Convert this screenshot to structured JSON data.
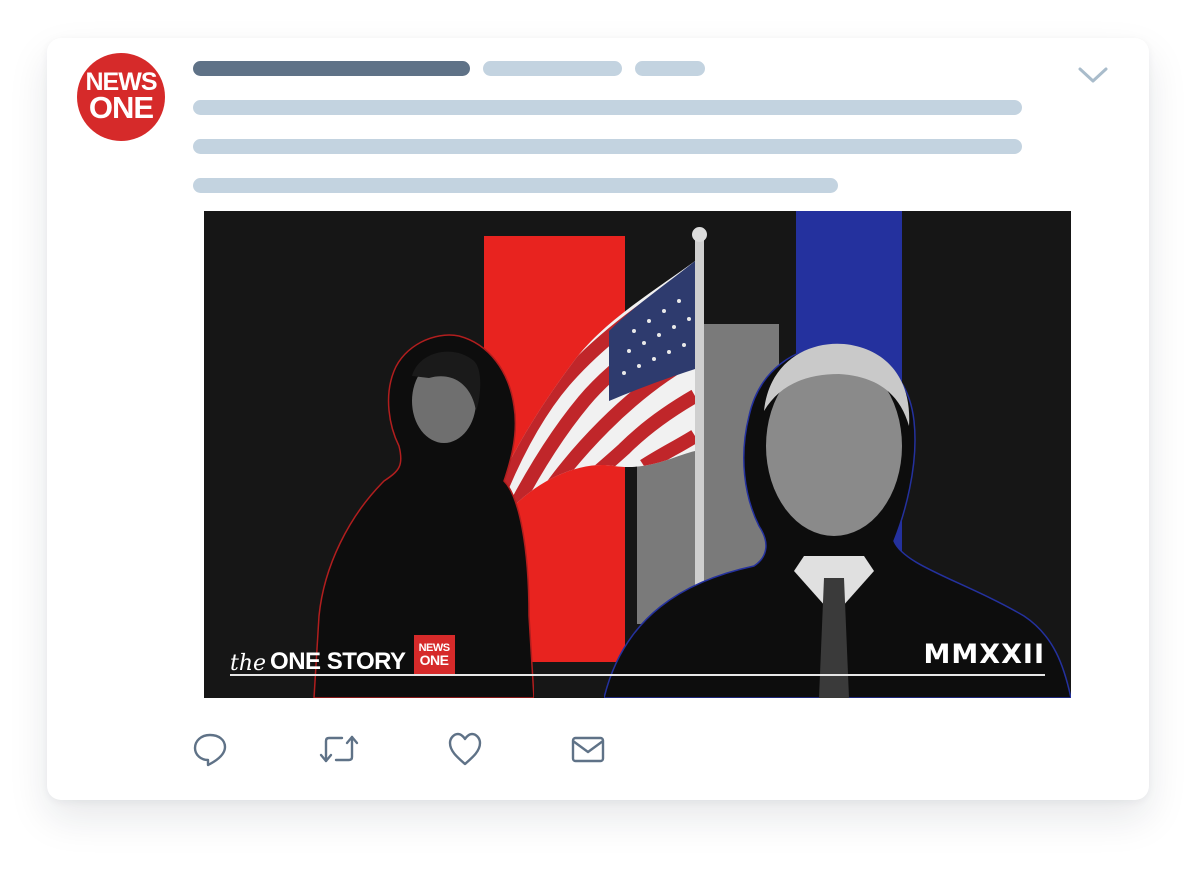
{
  "tweet": {
    "avatar": {
      "line1": "NEWS",
      "line2": "ONE",
      "color": "#d62a2a"
    },
    "menu_icon": "chevron-down-icon"
  },
  "media": {
    "brand_prefix": "the",
    "brand_title": "ONE STORY",
    "brand_logo": {
      "line1": "NEWS",
      "line2": "ONE"
    },
    "year": "MMXXII",
    "colors": {
      "red": "#e8231f",
      "blue": "#24319e",
      "gray": "#7a7a7a",
      "background": "#161616"
    }
  },
  "actions": [
    {
      "icon": "reply-icon"
    },
    {
      "icon": "retweet-icon"
    },
    {
      "icon": "like-icon"
    },
    {
      "icon": "share-dm-icon"
    }
  ]
}
